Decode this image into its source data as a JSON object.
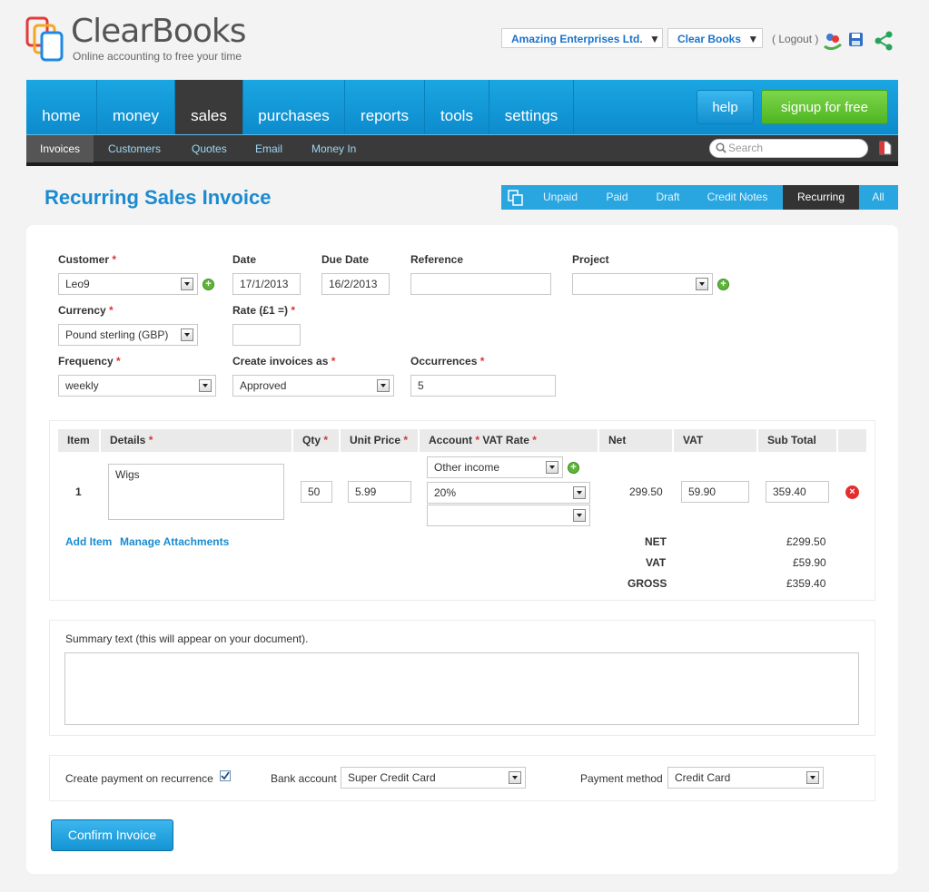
{
  "brand": {
    "name": "ClearBooks",
    "tagline": "Online accounting to free your time"
  },
  "topbar": {
    "company": "Amazing Enterprises Ltd.",
    "account": "Clear Books",
    "logout": "( Logout )"
  },
  "nav": {
    "items": [
      "home",
      "money",
      "sales",
      "purchases",
      "reports",
      "tools",
      "settings"
    ],
    "active": "sales",
    "help": "help",
    "signup": "signup for free"
  },
  "subnav": {
    "items": [
      "Invoices",
      "Customers",
      "Quotes",
      "Email",
      "Money In"
    ],
    "active": "Invoices",
    "search_placeholder": "Search"
  },
  "page": {
    "title": "Recurring Sales Invoice"
  },
  "filters": {
    "items": [
      "Unpaid",
      "Paid",
      "Draft",
      "Credit Notes",
      "Recurring",
      "All"
    ],
    "active": "Recurring"
  },
  "form": {
    "customer": {
      "label": "Customer",
      "value": "Leo9"
    },
    "date": {
      "label": "Date",
      "value": "17/1/2013"
    },
    "due_date": {
      "label": "Due Date",
      "value": "16/2/2013"
    },
    "reference": {
      "label": "Reference",
      "value": ""
    },
    "project": {
      "label": "Project",
      "value": ""
    },
    "currency": {
      "label": "Currency",
      "value": "Pound sterling (GBP)"
    },
    "rate": {
      "label": "Rate (£1 =)",
      "value": ""
    },
    "frequency": {
      "label": "Frequency",
      "value": "weekly"
    },
    "create_as": {
      "label": "Create invoices as",
      "value": "Approved"
    },
    "occurrences": {
      "label": "Occurrences",
      "value": "5"
    }
  },
  "items_table": {
    "headers": {
      "item": "Item",
      "details": "Details",
      "qty": "Qty",
      "unit_price": "Unit Price",
      "account_vat": "Account",
      "vat_rate": "VAT Rate",
      "net": "Net",
      "vat": "VAT",
      "subtotal": "Sub Total"
    },
    "rows": [
      {
        "item": "1",
        "details": "Wigs",
        "qty": "50",
        "unit_price": "5.99",
        "account": "Other income",
        "vat_rate": "20%",
        "extra": "",
        "net": "299.50",
        "vat": "59.90",
        "subtotal": "359.40"
      }
    ],
    "add_item": "Add Item",
    "manage_attachments": "Manage Attachments",
    "totals": [
      {
        "label": "NET",
        "value": "£299.50"
      },
      {
        "label": "VAT",
        "value": "£59.90"
      },
      {
        "label": "GROSS",
        "value": "£359.40"
      }
    ]
  },
  "summary": {
    "label": "Summary text (this will appear on your document).",
    "value": ""
  },
  "payment": {
    "create_label": "Create payment on recurrence",
    "create_checked": true,
    "bank_label": "Bank account",
    "bank_value": "Super Credit Card",
    "method_label": "Payment method",
    "method_value": "Credit Card"
  },
  "confirm": "Confirm Invoice"
}
